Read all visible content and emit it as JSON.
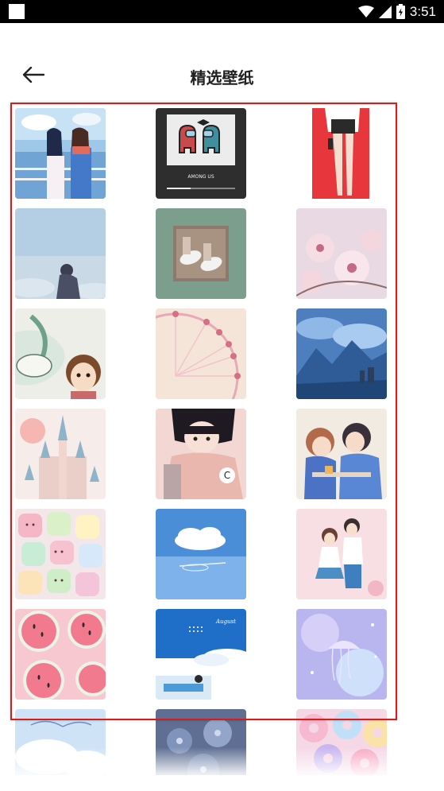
{
  "status_bar": {
    "time": "3:51"
  },
  "header": {
    "title": "精选壁纸",
    "back_icon": "arrow-left-icon"
  },
  "highlight_color": "#d71c1c",
  "wallpapers": [
    {
      "name": "anime-girls-ship",
      "text": ""
    },
    {
      "name": "among-us-crewmates",
      "text": "AMONG US"
    },
    {
      "name": "girl-red-background",
      "text": ""
    },
    {
      "name": "boy-sky",
      "text": ""
    },
    {
      "name": "sneakers-green",
      "text": ""
    },
    {
      "name": "cherry-blossoms",
      "text": ""
    },
    {
      "name": "haku-chihiro-dragon",
      "text": ""
    },
    {
      "name": "ferris-wheel-pink",
      "text": ""
    },
    {
      "name": "blue-mountains-clouds",
      "text": ""
    },
    {
      "name": "pink-castle",
      "text": ""
    },
    {
      "name": "anime-girl-coat",
      "text": ""
    },
    {
      "name": "anime-couple-blue",
      "text": ""
    },
    {
      "name": "marshmallows",
      "text": ""
    },
    {
      "name": "blue-sky-cloud",
      "text": ""
    },
    {
      "name": "school-couple-pink",
      "text": ""
    },
    {
      "name": "watermelon-slices",
      "text": ""
    },
    {
      "name": "blue-pool-calendar",
      "text": "August"
    },
    {
      "name": "purple-jellyfish",
      "text": ""
    },
    {
      "name": "blue-clouds-text",
      "text": ""
    },
    {
      "name": "blue-flowers",
      "text": ""
    },
    {
      "name": "donuts-pastel",
      "text": ""
    }
  ]
}
